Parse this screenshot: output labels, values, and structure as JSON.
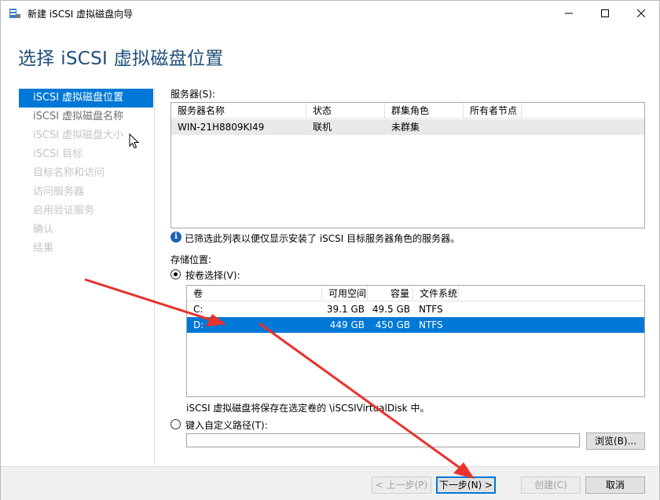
{
  "window": {
    "title": "新建 iSCSI 虚拟磁盘向导",
    "page_title": "选择 iSCSI 虚拟磁盘位置"
  },
  "nav": {
    "items": [
      {
        "label": "iSCSI 虚拟磁盘位置",
        "state": "active"
      },
      {
        "label": "iSCSI 虚拟磁盘名称",
        "state": "enabled"
      },
      {
        "label": "iSCSI 虚拟磁盘大小",
        "state": "disabled"
      },
      {
        "label": "iSCSI 目标",
        "state": "disabled"
      },
      {
        "label": "目标名称和访问",
        "state": "disabled"
      },
      {
        "label": "访问服务器",
        "state": "disabled"
      },
      {
        "label": "启用验证服务",
        "state": "disabled"
      },
      {
        "label": "确认",
        "state": "disabled"
      },
      {
        "label": "结果",
        "state": "disabled"
      }
    ]
  },
  "servers": {
    "label": "服务器(S):",
    "columns": [
      "服务器名称",
      "状态",
      "群集角色",
      "所有者节点"
    ],
    "rows": [
      {
        "name": "WIN-21H8809KI49",
        "status": "联机",
        "role": "未群集",
        "owner": ""
      }
    ]
  },
  "info_text": "已筛选此列表以便仅显示安装了 iSCSI 目标服务器角色的服务器。",
  "storage": {
    "label": "存储位置:",
    "by_volume_label": "按卷选择(V):",
    "by_volume_selected": true,
    "columns": [
      "卷",
      "可用空间",
      "容量",
      "文件系统"
    ],
    "volumes": [
      {
        "volume": "C:",
        "free": "39.1 GB",
        "capacity": "49.5 GB",
        "fs": "NTFS",
        "selected": false
      },
      {
        "volume": "D:",
        "free": "449 GB",
        "capacity": "450 GB",
        "fs": "NTFS",
        "selected": true
      }
    ],
    "note": "iSCSI 虚拟磁盘将保存在选定卷的 \\iSCSIVirtualDisk 中。",
    "custom_path_label": "键入自定义路径(T):",
    "custom_path_value": "",
    "browse_label": "浏览(B)..."
  },
  "footer": {
    "prev_label": "< 上一步(P)",
    "next_label": "下一步(N) >",
    "create_label": "创建(C)",
    "cancel_label": "取消"
  },
  "colors": {
    "accent": "#0078d7",
    "title": "#1e4e79",
    "annotation_arrow": "#e8322b"
  }
}
